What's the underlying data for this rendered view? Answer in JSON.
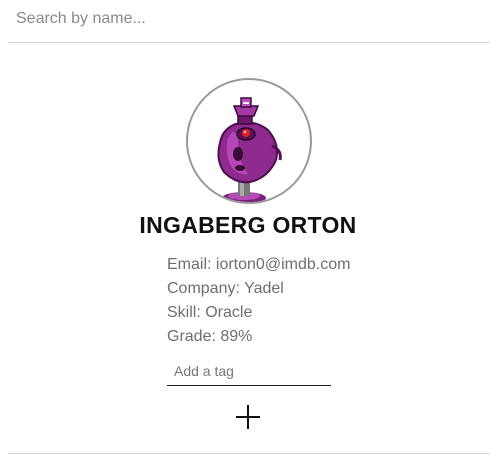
{
  "search": {
    "placeholder": "Search by name..."
  },
  "student": {
    "avatar_icon": "robot-avatar-icon",
    "name": "INGABERG ORTON",
    "email": "Email: iorton0@imdb.com",
    "company": "Company: Yadel",
    "skill": "Skill: Oracle",
    "grade": "Grade: 89%"
  },
  "tag_input": {
    "placeholder": "Add a tag"
  },
  "expand_button": {
    "icon": "plus-icon"
  },
  "colors": {
    "avatar_primary": "#8f2a8f",
    "avatar_secondary": "#c04fc0",
    "detail_text": "#6e6e6e",
    "divider": "#d6d6d6"
  }
}
